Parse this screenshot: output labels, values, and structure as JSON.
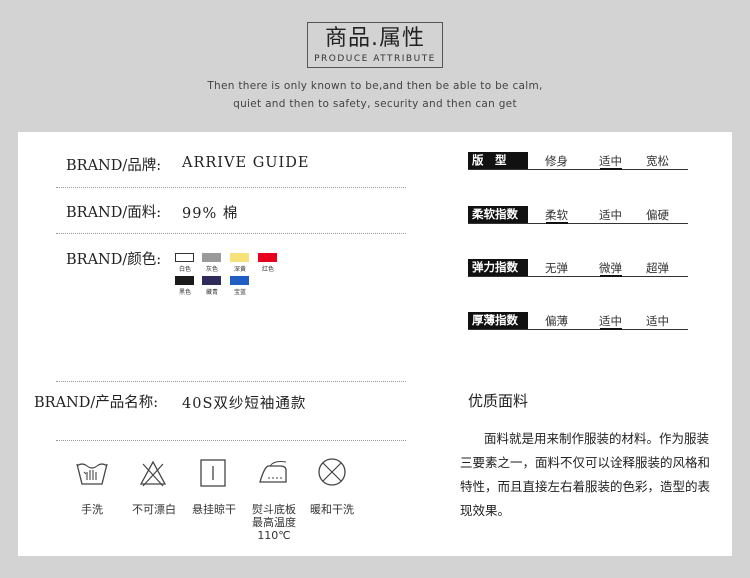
{
  "header": {
    "title_zh": "商品.属性",
    "title_en": "PRODUCE ATTRIBUTE",
    "subtitle_1": "Then there is only known to be,and then be able to be calm,",
    "subtitle_2": "quiet and then to safety, security and then can get"
  },
  "left": {
    "brand_label": "BRAND/品牌:",
    "brand_value": "ARRIVE GUIDE",
    "fabric_label": "BRAND/面料:",
    "fabric_value": "99% 棉",
    "color_label": "BRAND/颜色:",
    "colors": [
      {
        "name": "白色",
        "hex": "#ffffff"
      },
      {
        "name": "灰色",
        "hex": "#9a9a9a"
      },
      {
        "name": "深黄",
        "hex": "#f6e27a"
      },
      {
        "name": "红色",
        "hex": "#e8001c"
      },
      {
        "name": "黑色",
        "hex": "#1a1a1a"
      },
      {
        "name": "藏青",
        "hex": "#2e2a5a"
      },
      {
        "name": "宝蓝",
        "hex": "#1f5fc4"
      }
    ],
    "product_label": "BRAND/产品名称:",
    "product_value": "40S双纱短袖通款"
  },
  "attributes": [
    {
      "label": "版　型",
      "options": [
        "修身",
        "适中",
        "宽松"
      ],
      "selected": 1
    },
    {
      "label": "柔软指数",
      "options": [
        "柔软",
        "适中",
        "偏硬"
      ],
      "selected": 0
    },
    {
      "label": "弹力指数",
      "options": [
        "无弹",
        "微弹",
        "超弹"
      ],
      "selected": 1
    },
    {
      "label": "厚薄指数",
      "options": [
        "偏薄",
        "适中",
        "适中"
      ],
      "selected": 1
    }
  ],
  "quality": {
    "heading": "优质面料",
    "paragraph": "面料就是用来制作服装的材料。作为服装三要素之一，面料不仅可以诠释服装的风格和特性，而且直接左右着服装的色彩，造型的表现效果。"
  },
  "care": [
    {
      "icon": "hand-wash-icon",
      "label": "手洗"
    },
    {
      "icon": "no-bleach-icon",
      "label": "不可漂白"
    },
    {
      "icon": "hang-dry-icon",
      "label": "悬挂晾干"
    },
    {
      "icon": "iron-icon",
      "label": "熨斗底板\n最高温度\n110℃"
    },
    {
      "icon": "no-dry-clean-icon",
      "label": "暖和干洗"
    }
  ]
}
